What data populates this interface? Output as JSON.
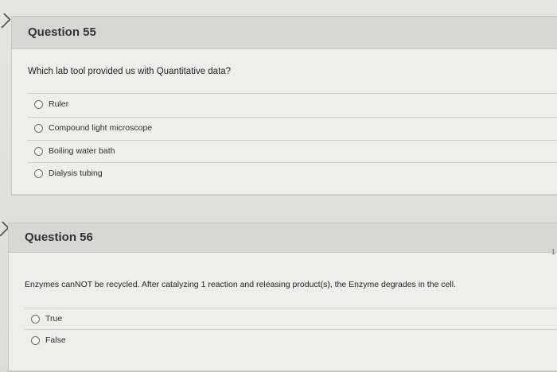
{
  "q55": {
    "title": "Question 55",
    "prompt": "Which lab tool provided us with Quantitative data?",
    "options": [
      "Ruler",
      "Compound light microscope",
      "Boiling water bath",
      "Dialysis tubing"
    ]
  },
  "q56": {
    "title": "Question 56",
    "prompt": "Enzymes canNOT be recycled. After catalyzing 1 reaction and releasing product(s), the Enzyme degrades in the cell.",
    "options": [
      "True",
      "False"
    ]
  },
  "edge_text": "1"
}
